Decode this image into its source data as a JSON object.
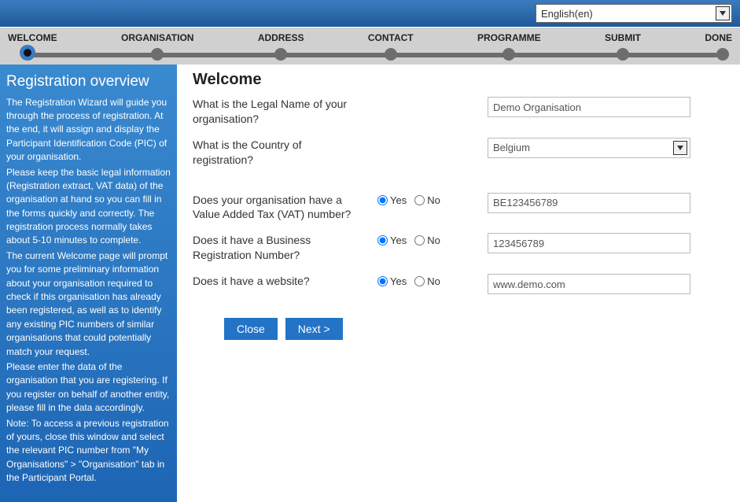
{
  "lang_selector": {
    "value": "English(en)"
  },
  "steps": [
    "WELCOME",
    "ORGANISATION",
    "ADDRESS",
    "CONTACT",
    "PROGRAMME",
    "SUBMIT",
    "DONE"
  ],
  "sidebar": {
    "title": "Registration overview",
    "p1": "The Registration Wizard will guide you through the process of registration. At the end, it will assign and display the Participant Identification Code (PIC) of your organisation.",
    "p2": "Please keep the basic legal information (Registration extract, VAT data) of the organisation at hand so you can fill in the forms quickly and correctly. The registration process normally takes about 5-10 minutes to complete.",
    "p3": "The current Welcome page will prompt you for some preliminary information about your organisation required to check if this organisation has already been registered, as well as to identify any existing PIC numbers of similar organisations that could potentially match your request.",
    "p4": "Please enter the data of the organisation that you are registering. If you register on behalf of another entity, please fill in the data accordingly.",
    "p5": "Note: To access a previous registration of yours, close this window and select the relevant PIC number from \"My Organisations\" > \"Organisation\" tab in the Participant Portal."
  },
  "main": {
    "heading": "Welcome",
    "q_legal_name": "What is the Legal Name of your organisation?",
    "q_country": "What is the Country of registration?",
    "q_vat": "Does your organisation have a Value Added Tax (VAT) number?",
    "q_brn": "Does it have a Business Registration Number?",
    "q_website": "Does it have a website?",
    "yes": "Yes",
    "no": "No",
    "legal_name_value": "Demo Organisation",
    "country_value": "Belgium",
    "vat_value": "BE123456789",
    "brn_value": "123456789",
    "website_value": "www.demo.com"
  },
  "buttons": {
    "close": "Close",
    "next": "Next >"
  }
}
